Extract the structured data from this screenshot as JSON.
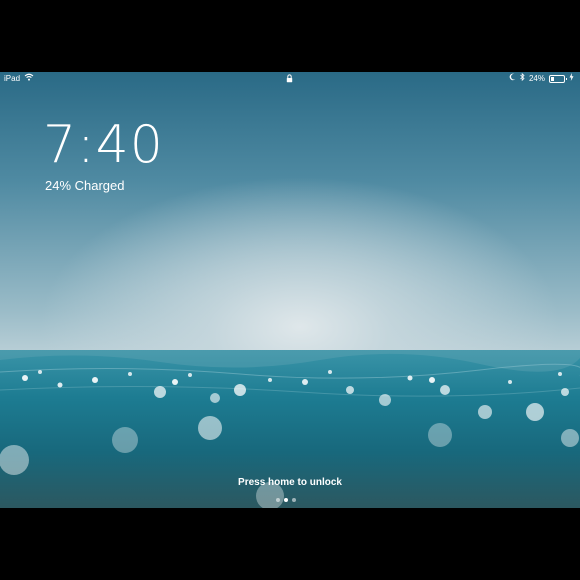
{
  "status_bar": {
    "device": "iPad",
    "wifi_icon": "wifi-icon",
    "lock_icon": "lock-icon",
    "moon_icon": "moon-icon",
    "bluetooth_icon": "bluetooth-icon",
    "battery_percent": "24%",
    "battery_level": 0.24,
    "charging_icon": "charging-bolt-icon"
  },
  "lock_screen": {
    "time": "7:40",
    "charge_status": "24% Charged",
    "unlock_hint": "Press home to unlock",
    "page_dots": 3,
    "active_dot": 1
  },
  "colors": {
    "text": "#ffffff",
    "sky": "#4f8aa2",
    "sea": "#1d7c92"
  }
}
